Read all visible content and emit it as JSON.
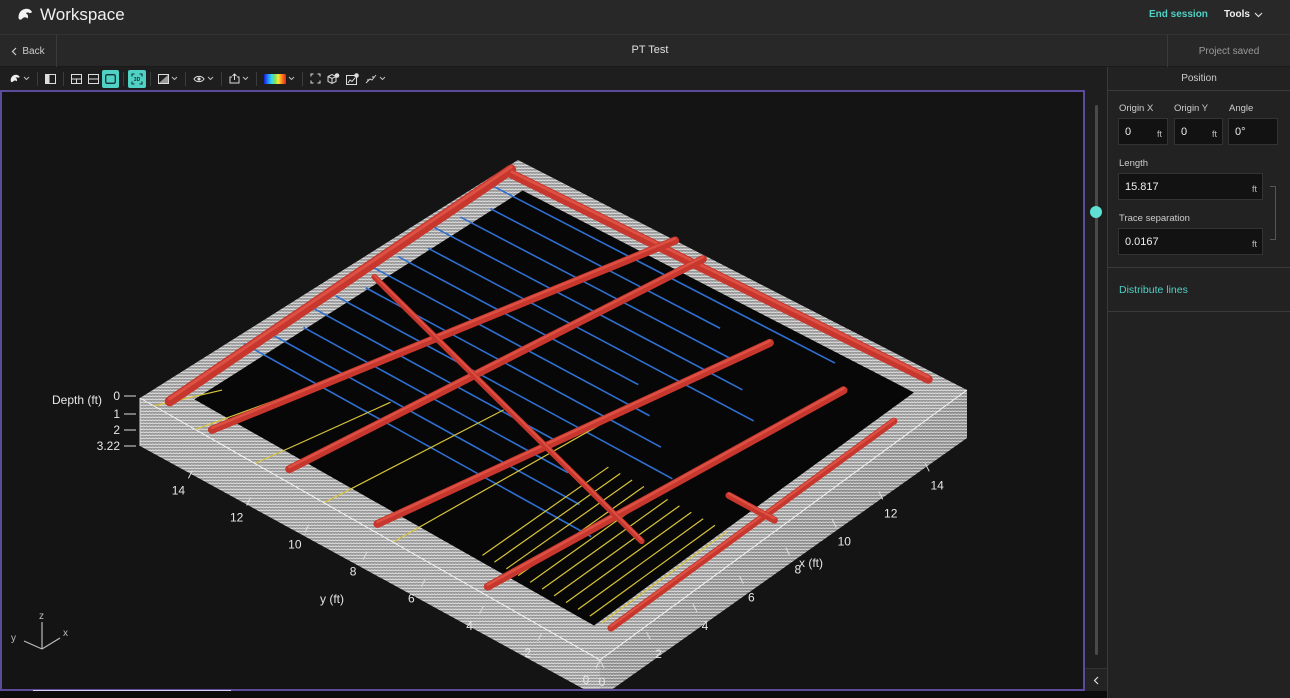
{
  "app": {
    "title": "Workspace",
    "logo_icon": "eagle-logo-icon",
    "end_session_label": "End session",
    "tools_label": "Tools"
  },
  "subheader": {
    "back_label": "Back",
    "project_title": "PT Test",
    "save_status": "Project saved"
  },
  "toolbar": {
    "items": [
      {
        "name": "scene-menu",
        "icon": "eagle-icon",
        "dropdown": true
      },
      {
        "name": "toggle-sidebar",
        "icon": "sidebar-icon"
      },
      {
        "name": "layout-split",
        "icon": "layout-split-icon"
      },
      {
        "name": "layout-horizontal",
        "icon": "layout-rows-icon"
      },
      {
        "name": "layout-single",
        "icon": "layout-single-icon",
        "active": true
      },
      {
        "name": "view-3d",
        "icon": "3d-view-icon",
        "active": true
      },
      {
        "name": "display-mode",
        "icon": "image-icon",
        "dropdown": true
      },
      {
        "name": "visibility",
        "icon": "eye-icon",
        "dropdown": true
      },
      {
        "name": "export",
        "icon": "export-icon",
        "dropdown": true
      },
      {
        "name": "colormap",
        "icon": "colormap-icon",
        "dropdown": true
      },
      {
        "name": "fit-view",
        "icon": "fullscreen-icon"
      },
      {
        "name": "add-object",
        "icon": "cube-add-icon"
      },
      {
        "name": "add-panel",
        "icon": "chart-add-icon"
      },
      {
        "name": "annotations",
        "icon": "scatter-icon",
        "dropdown": true
      }
    ],
    "active_color": "#4fd1c5"
  },
  "viewport": {
    "border_color": "#5c4a9a",
    "depth_axis": {
      "label": "Depth (ft)",
      "ticks": [
        "0",
        "1",
        "2",
        "3.22"
      ]
    },
    "x_axis": {
      "label": "x (ft)",
      "ticks": [
        "0",
        "2",
        "4",
        "6",
        "8",
        "10",
        "12",
        "14"
      ]
    },
    "y_axis": {
      "label": "y (ft)",
      "ticks": [
        "0",
        "2",
        "4",
        "6",
        "8",
        "10",
        "12",
        "14"
      ]
    },
    "orientation_gizmo": {
      "x": "x",
      "y": "y",
      "z": "z"
    },
    "layer_colors": {
      "utility": "#c8372d",
      "blue_lines": "#2f6fd0",
      "yellow_lines": "#d8c43a"
    },
    "slider_position": 0.195
  },
  "panel": {
    "title": "Position",
    "origin_x": {
      "label": "Origin X",
      "value": "0",
      "unit": "ft"
    },
    "origin_y": {
      "label": "Origin Y",
      "value": "0",
      "unit": "ft"
    },
    "angle": {
      "label": "Angle",
      "value": "0°"
    },
    "length": {
      "label": "Length",
      "value": "15.817",
      "unit": "ft"
    },
    "trace_separation": {
      "label": "Trace separation",
      "value": "0.0167",
      "unit": "ft"
    },
    "distribute_label": "Distribute lines"
  }
}
